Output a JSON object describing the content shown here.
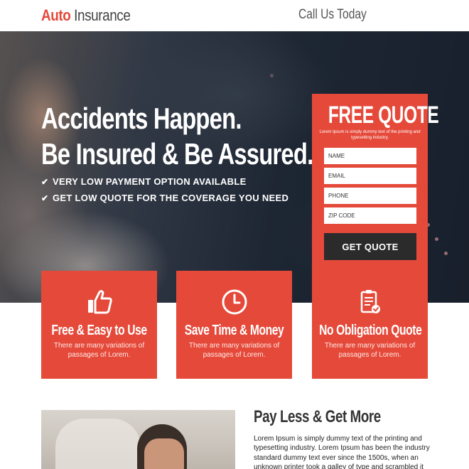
{
  "header": {
    "logo_brand": "Auto",
    "logo_rest": " Insurance",
    "call": "Call Us Today"
  },
  "hero": {
    "headline_1": "Accidents Happen.",
    "headline_2": "Be Insured & Be Assured.",
    "bullets": [
      "VERY LOW PAYMENT OPTION AVAILABLE",
      "GET LOW QUOTE FOR THE COVERAGE YOU NEED"
    ]
  },
  "quote_form": {
    "title": "FREE QUOTE",
    "subtitle": "Lorem Ipsum is simply dummy text of the printing and typesetting industry.",
    "name_placeholder": "NAME",
    "email_placeholder": "EMAIL",
    "phone_placeholder": "PHONE",
    "zip_placeholder": "ZIP CODE",
    "button": "GET QUOTE"
  },
  "features": [
    {
      "icon": "thumbs-up-icon",
      "title": "Free & Easy to Use",
      "text": "There are many variations of passages of Lorem."
    },
    {
      "icon": "clock-icon",
      "title": "Save Time & Money",
      "text": "There are many variations of passages of Lorem."
    },
    {
      "icon": "clipboard-check-icon",
      "title": "No Obligation Quote",
      "text": "There are many variations of passages of Lorem."
    }
  ],
  "section": {
    "title": "Pay Less & Get More",
    "body": "Lorem Ipsum is simply dummy text of the printing and typesetting industry. Lorem Ipsum has been the industry standard dummy text ever since the 1500s, when an unknown printer took a galley of type and scrambled it"
  },
  "colors": {
    "accent": "#e5493a",
    "button_dark": "#2b2b2b",
    "header_bg": "#ffffff"
  }
}
